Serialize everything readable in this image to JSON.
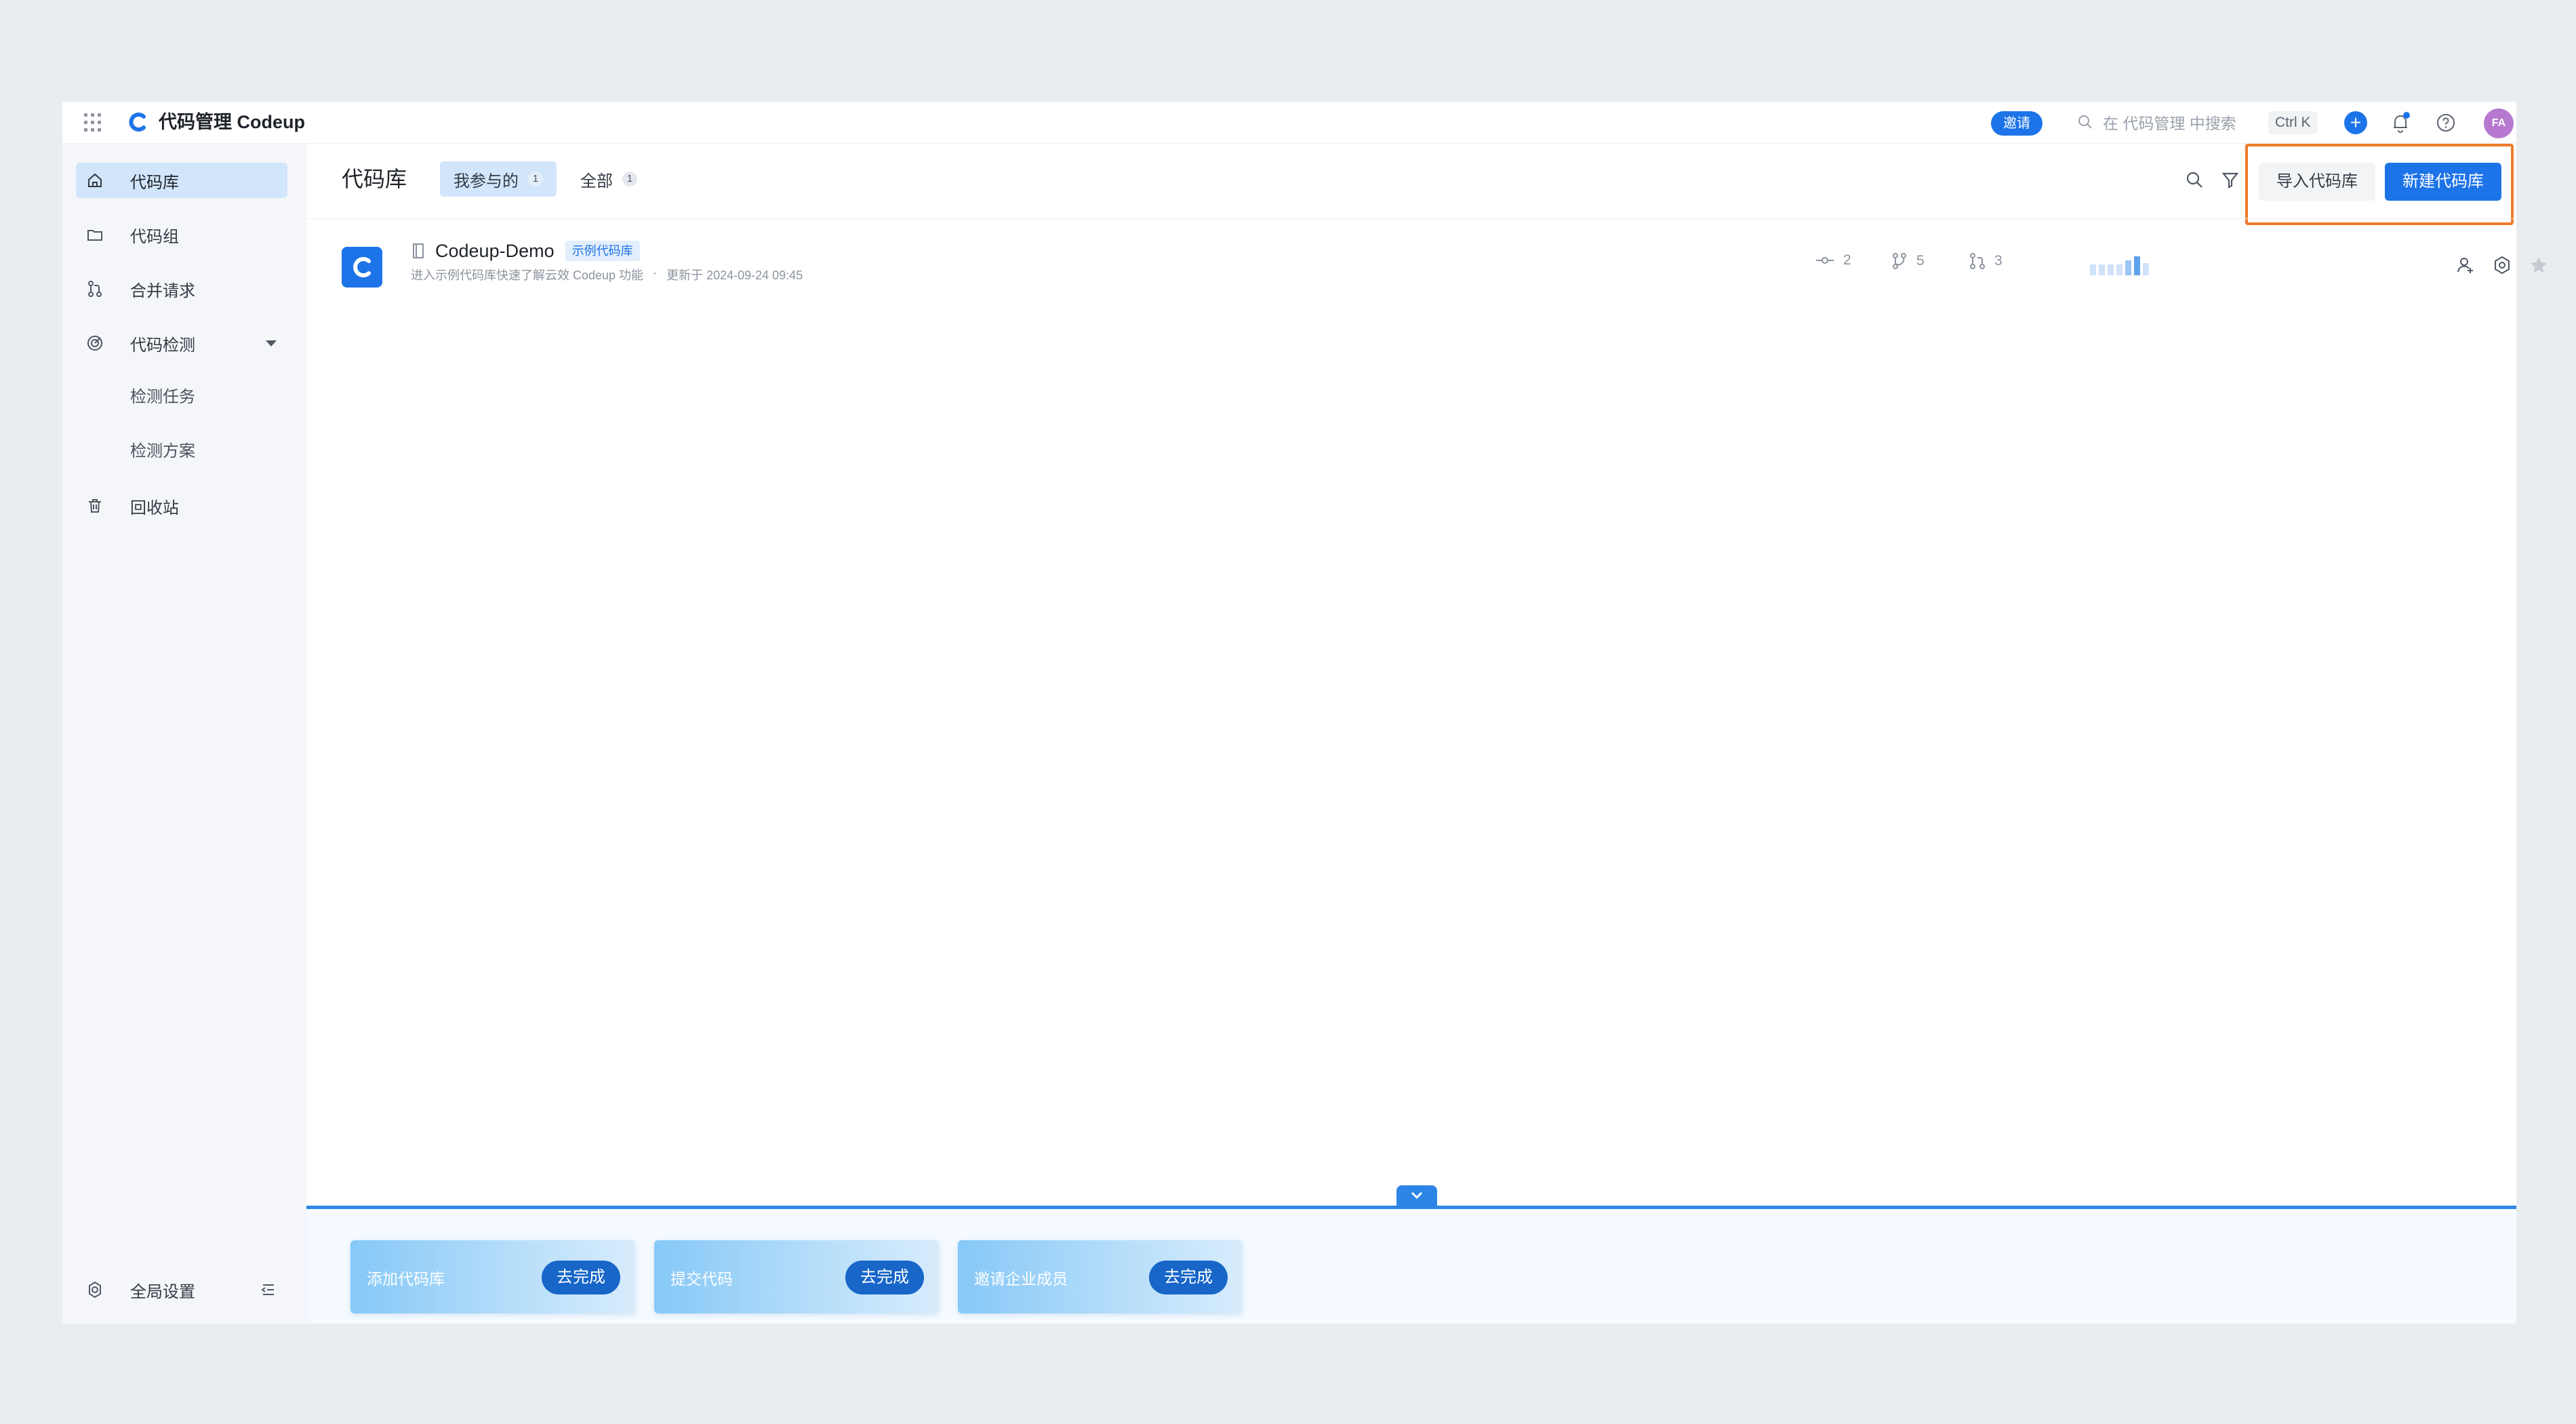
{
  "topbar": {
    "title": "代码管理 Codeup",
    "invite_label": "邀请",
    "search_placeholder": "在 代码管理 中搜索",
    "shortcut": "Ctrl K",
    "plus_label": "+",
    "avatar_text": "FA"
  },
  "sidebar": {
    "items": [
      {
        "label": "代码库",
        "icon": "home-icon",
        "active": true
      },
      {
        "label": "代码组",
        "icon": "folder-icon"
      },
      {
        "label": "合并请求",
        "icon": "merge-request-icon"
      },
      {
        "label": "代码检测",
        "icon": "scan-icon"
      }
    ],
    "sub_items": [
      {
        "label": "检测任务"
      },
      {
        "label": "检测方案"
      }
    ],
    "recycle_label": "回收站",
    "global_settings_label": "全局设置"
  },
  "main": {
    "title": "代码库",
    "tabs": [
      {
        "label": "我参与的",
        "count": "1",
        "active": true
      },
      {
        "label": "全部",
        "count": "1"
      }
    ],
    "import_button": "导入代码库",
    "new_button": "新建代码库"
  },
  "repos": [
    {
      "name": "Codeup-Demo",
      "tag": "示例代码库",
      "description": "进入示例代码库快速了解云效 Codeup 功能",
      "separator": "·",
      "updated": "更新于 2024-09-24 09:45",
      "commits": "2",
      "branches": "5",
      "merge_requests": "3"
    }
  ],
  "onboarding": {
    "tasks": [
      {
        "label": "添加代码库",
        "action": "去完成"
      },
      {
        "label": "提交代码",
        "action": "去完成"
      },
      {
        "label": "邀请企业成员",
        "action": "去完成"
      }
    ]
  },
  "colors": {
    "accent": "#1d74e8",
    "highlight": "#ef7a2a",
    "avatar": "#b679cf"
  }
}
